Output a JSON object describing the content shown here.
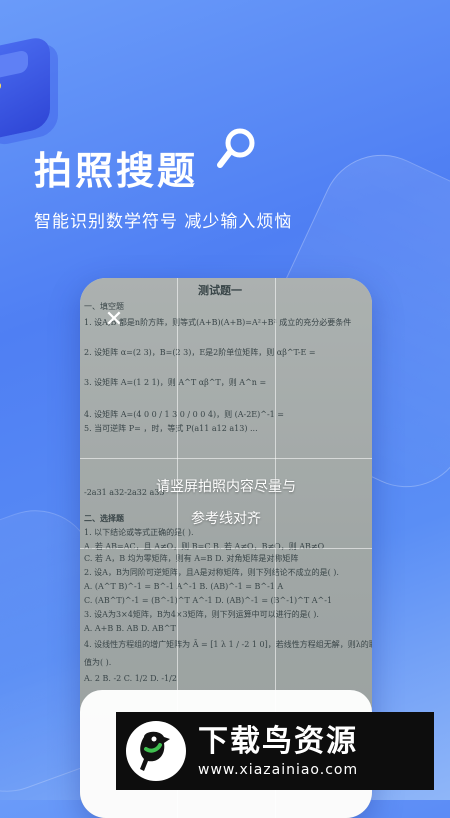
{
  "header": {
    "title": "拍照搜题",
    "subtitle": "智能识别数学符号 减少输入烦恼"
  },
  "camera": {
    "close_icon": "close-icon",
    "hint_line1": "请竖屏拍照内容尽量与",
    "hint_line2": "参考线对齐"
  },
  "paper": {
    "heading": "测试题一",
    "section1": "一、填空题",
    "lines": [
      "1. 设A,B 都是n阶方阵，则等式(A+B)(A+B)=A²+B² 成立的充分必要条件",
      "2. 设矩阵 α=(2 3)，B=(2 3)，E是2阶单位矩阵，则 αβ^T-E =",
      "3. 设矩阵 A=(1 2 1)，则 A^T αβ^T，则 A^n =",
      "4. 设矩阵 A=(4 0 0 / 1 3 0 / 0 0 4)，则 (A-2E)^-1 =",
      "5. 当可逆阵 P= ，时，等式 P(a11 a12 a13) ...",
      "-2a31   a32-2a32   a33",
      "二、选择题",
      "1. 以下结论或等式正确的是(   ).",
      "A. 若 AB=AC，且 A≠O，则 B=C     B. 若 A≠O，B≠O，则 AB≠O",
      "C. 若 A，B 均为零矩阵，则有 A=B     D. 对角矩阵是对称矩阵",
      "2. 设A，B为同阶可逆矩阵，且A是对称矩阵，则下列结论不成立的是(   ).",
      "A. (A^T B)^-1 = B^-1 A^-1        B. (AB)^-1 = B^-1 A",
      "C. (AB^T)^-1 = (B^-1)^T A^-1      D. (AB)^-1 = (B^-1)^T A^-1",
      "3. 设A为3×4矩阵，B为4×3矩阵，则下列运算中可以进行的是(   ).",
      "A. A+B        B. AB        D. AB^T",
      "4. 设线性方程组的增广矩阵为 Ā = [1 λ 1 / -2 1 0]，若线性方程组无解，则λ的取",
      "值为(   ).",
      "A. 2        B. -2        C. 1/2        D. -1/2"
    ]
  },
  "watermark": {
    "name": "下载鸟资源",
    "url": "www.xiazainiao.com"
  },
  "colors": {
    "background": "#5a8ef5",
    "accent": "#4f7ff3",
    "text": "#ffffff",
    "watermark_green": "#3fbf4f"
  }
}
